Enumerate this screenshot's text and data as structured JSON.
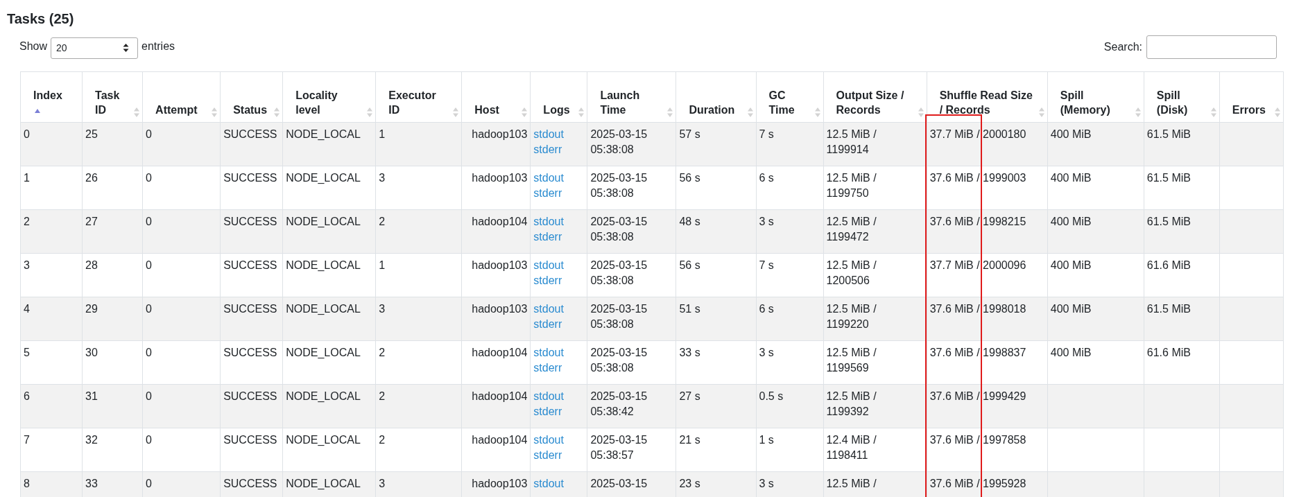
{
  "title": "Tasks (25)",
  "length_control": {
    "label_before": "Show",
    "value": "20",
    "label_after": "entries"
  },
  "search": {
    "label": "Search:"
  },
  "columns": [
    {
      "label": "Index",
      "sorted_ascending": true,
      "highlighted": false
    },
    {
      "label": "Task ID",
      "sorted_ascending": false,
      "highlighted": false
    },
    {
      "label": "Attempt",
      "sorted_ascending": false,
      "highlighted": false
    },
    {
      "label": "Status",
      "sorted_ascending": false,
      "highlighted": false
    },
    {
      "label": "Locality level",
      "sorted_ascending": false,
      "highlighted": false
    },
    {
      "label": "Executor ID",
      "sorted_ascending": false,
      "highlighted": false
    },
    {
      "label": "Host",
      "sorted_ascending": false,
      "highlighted": false
    },
    {
      "label": "Logs",
      "sorted_ascending": false,
      "highlighted": false
    },
    {
      "label": "Launch Time",
      "sorted_ascending": false,
      "highlighted": false
    },
    {
      "label": "Duration",
      "sorted_ascending": false,
      "highlighted": false
    },
    {
      "label": "GC Time",
      "sorted_ascending": false,
      "highlighted": false
    },
    {
      "label": "Output Size / Records",
      "sorted_ascending": false,
      "highlighted": false
    },
    {
      "label": "Shuffle Read Size / Records",
      "sorted_ascending": false,
      "highlighted": true
    },
    {
      "label": "Spill (Memory)",
      "sorted_ascending": false,
      "highlighted": false
    },
    {
      "label": "Spill (Disk)",
      "sorted_ascending": false,
      "highlighted": false
    },
    {
      "label": "Errors",
      "sorted_ascending": false,
      "highlighted": false
    }
  ],
  "rows": [
    {
      "cells": [
        "0",
        "25",
        "0",
        "SUCCESS",
        "NODE_LOCAL",
        "1",
        "hadoop103",
        [
          "stdout",
          "stderr"
        ],
        "2025-03-15 05:38:08",
        "57 s",
        "7 s",
        "12.5 MiB / 1199914",
        "37.7 MiB / 2000180",
        "400 MiB",
        "61.5 MiB",
        ""
      ]
    },
    {
      "cells": [
        "1",
        "26",
        "0",
        "SUCCESS",
        "NODE_LOCAL",
        "3",
        "hadoop103",
        [
          "stdout",
          "stderr"
        ],
        "2025-03-15 05:38:08",
        "56 s",
        "6 s",
        "12.5 MiB / 1199750",
        "37.6 MiB / 1999003",
        "400 MiB",
        "61.5 MiB",
        ""
      ]
    },
    {
      "cells": [
        "2",
        "27",
        "0",
        "SUCCESS",
        "NODE_LOCAL",
        "2",
        "hadoop104",
        [
          "stdout",
          "stderr"
        ],
        "2025-03-15 05:38:08",
        "48 s",
        "3 s",
        "12.5 MiB / 1199472",
        "37.6 MiB / 1998215",
        "400 MiB",
        "61.5 MiB",
        ""
      ]
    },
    {
      "cells": [
        "3",
        "28",
        "0",
        "SUCCESS",
        "NODE_LOCAL",
        "1",
        "hadoop103",
        [
          "stdout",
          "stderr"
        ],
        "2025-03-15 05:38:08",
        "56 s",
        "7 s",
        "12.5 MiB / 1200506",
        "37.7 MiB / 2000096",
        "400 MiB",
        "61.6 MiB",
        ""
      ]
    },
    {
      "cells": [
        "4",
        "29",
        "0",
        "SUCCESS",
        "NODE_LOCAL",
        "3",
        "hadoop103",
        [
          "stdout",
          "stderr"
        ],
        "2025-03-15 05:38:08",
        "51 s",
        "6 s",
        "12.5 MiB / 1199220",
        "37.6 MiB / 1998018",
        "400 MiB",
        "61.5 MiB",
        ""
      ]
    },
    {
      "cells": [
        "5",
        "30",
        "0",
        "SUCCESS",
        "NODE_LOCAL",
        "2",
        "hadoop104",
        [
          "stdout",
          "stderr"
        ],
        "2025-03-15 05:38:08",
        "33 s",
        "3 s",
        "12.5 MiB / 1199569",
        "37.6 MiB / 1998837",
        "400 MiB",
        "61.6 MiB",
        ""
      ]
    },
    {
      "cells": [
        "6",
        "31",
        "0",
        "SUCCESS",
        "NODE_LOCAL",
        "2",
        "hadoop104",
        [
          "stdout",
          "stderr"
        ],
        "2025-03-15 05:38:42",
        "27 s",
        "0.5 s",
        "12.5 MiB / 1199392",
        "37.6 MiB / 1999429",
        "",
        "",
        ""
      ]
    },
    {
      "cells": [
        "7",
        "32",
        "0",
        "SUCCESS",
        "NODE_LOCAL",
        "2",
        "hadoop104",
        [
          "stdout",
          "stderr"
        ],
        "2025-03-15 05:38:57",
        "21 s",
        "1 s",
        "12.4 MiB / 1198411",
        "37.6 MiB / 1997858",
        "",
        "",
        ""
      ]
    },
    {
      "cells": [
        "8",
        "33",
        "0",
        "SUCCESS",
        "NODE_LOCAL",
        "3",
        "hadoop103",
        [
          "stdout"
        ],
        "2025-03-15",
        "23 s",
        "3 s",
        "12.5 MiB /",
        "37.6 MiB / 1995928",
        "",
        "",
        ""
      ]
    }
  ]
}
